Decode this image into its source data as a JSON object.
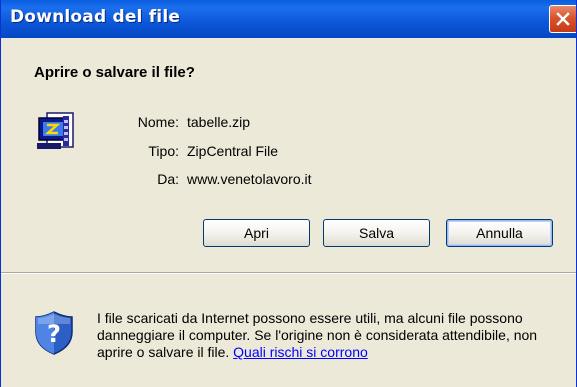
{
  "window": {
    "title": "Download del file",
    "close_icon": "close-icon"
  },
  "dialog": {
    "question": "Aprire o salvare il file?",
    "file_icon": "zip-archive-icon",
    "fields": {
      "name_label": "Nome:",
      "name_value": "tabelle.zip",
      "type_label": "Tipo:",
      "type_value": "ZipCentral File",
      "from_label": "Da:",
      "from_value": "www.venetolavoro.it"
    },
    "buttons": {
      "open_label": "Apri",
      "save_label": "Salva",
      "cancel_label": "Annulla"
    },
    "warning": {
      "icon": "security-shield-question-icon",
      "text": "I file scaricati da Internet possono essere utili, ma alcuni file possono danneggiare il computer. Se l'origine non è considerata attendibile, non aprire o salvare il file.",
      "link_label": "Quali rischi si corrono"
    }
  },
  "colors": {
    "titlebar": "#0b57d8",
    "dialog_bg": "#ece9d8",
    "link": "#0000ff",
    "close_button": "#d9542c"
  }
}
